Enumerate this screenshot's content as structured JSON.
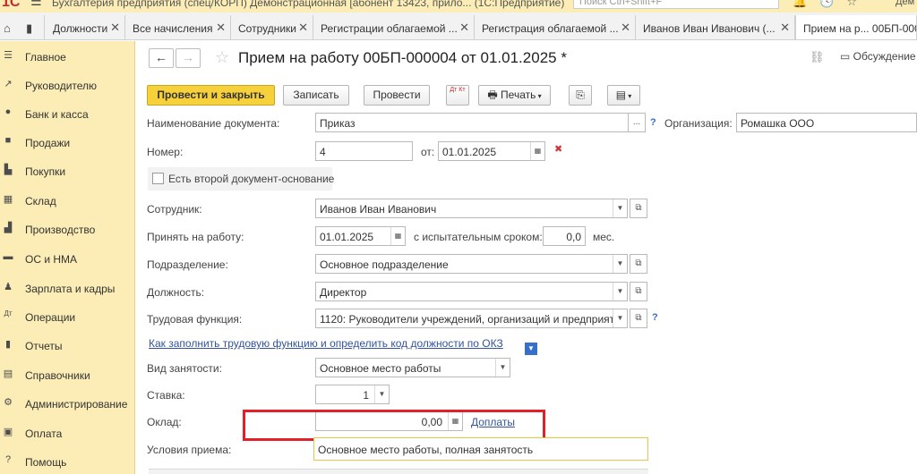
{
  "titlebar": {
    "title": "Бухгалтерия предприятия (спец/КОРП) Демонстрационная [абонент 13423, прило...    (1С:Предприятие)",
    "search_placeholder": "Поиск Ctrl+Shift+F",
    "user": "Дем"
  },
  "tabs": [
    {
      "label": "Должности"
    },
    {
      "label": "Все начисления"
    },
    {
      "label": "Сотрудники"
    },
    {
      "label": "Регистрации облагаемой ..."
    },
    {
      "label": "Регистрация облагаемой ..."
    },
    {
      "label": "Иванов Иван Иванович (..."
    },
    {
      "label": "Прием на р...  00БП-000"
    }
  ],
  "sidebar": {
    "items": [
      {
        "label": "Главное",
        "icon": "menu-lines-icon"
      },
      {
        "label": "Руководителю",
        "icon": "trend-icon"
      },
      {
        "label": "Банк и касса",
        "icon": "coin-icon"
      },
      {
        "label": "Продажи",
        "icon": "bag-icon"
      },
      {
        "label": "Покупки",
        "icon": "cart-icon"
      },
      {
        "label": "Склад",
        "icon": "warehouse-icon"
      },
      {
        "label": "Производство",
        "icon": "factory-icon"
      },
      {
        "label": "ОС и НМА",
        "icon": "truck-icon"
      },
      {
        "label": "Зарплата и кадры",
        "icon": "person-icon"
      },
      {
        "label": "Операции",
        "icon": "dt-kt-icon"
      },
      {
        "label": "Отчеты",
        "icon": "bar-chart-icon"
      },
      {
        "label": "Справочники",
        "icon": "book-icon"
      },
      {
        "label": "Администрирование",
        "icon": "gear-icon"
      },
      {
        "label": "Оплата",
        "icon": "payment-icon"
      },
      {
        "label": "Помощь",
        "icon": "help-icon"
      }
    ]
  },
  "doc": {
    "title": "Прием на работу 00БП-000004 от 01.01.2025 *",
    "discuss": "Обсуждение"
  },
  "toolbar": {
    "post_close": "Провести и закрыть",
    "save": "Записать",
    "post": "Провести",
    "dtkt": "Дт Кт",
    "print": "Печать"
  },
  "form": {
    "doc_name_label": "Наименование документа:",
    "doc_name_value": "Приказ",
    "org_label": "Организация:",
    "org_value": "Ромашка ООО",
    "number_label": "Номер:",
    "number_value": "4",
    "from_label": "от:",
    "date_value": "01.01.2025",
    "second_doc_label": "Есть второй документ-основание",
    "employee_label": "Сотрудник:",
    "employee_value": "Иванов Иван Иванович",
    "hire_label": "Принять на работу:",
    "hire_date": "01.01.2025",
    "trial_label": "с испытательным сроком:",
    "trial_value": "0,0",
    "trial_unit": "мес.",
    "dept_label": "Подразделение:",
    "dept_value": "Основное подразделение",
    "position_label": "Должность:",
    "position_value": "Директор",
    "labor_label": "Трудовая функция:",
    "labor_value": "1120: Руководители учреждений, организаций и предприяти",
    "okz_link": "Как заполнить трудовую функцию и определить код должности по ОКЗ",
    "employment_label": "Вид занятости:",
    "employment_value": "Основное место работы",
    "rate_label": "Ставка:",
    "rate_value": "1",
    "salary_label": "Оклад:",
    "salary_value": "0,00",
    "extra_link": "Доплаты",
    "conditions_label": "Условия приема:",
    "conditions_value": "Основное место работы, полная занятость"
  },
  "colors": {
    "sidebar_bg": "#fbedb5",
    "primary_button": "#f6d13b",
    "highlight_box": "#e1202a",
    "link": "#33539b"
  }
}
